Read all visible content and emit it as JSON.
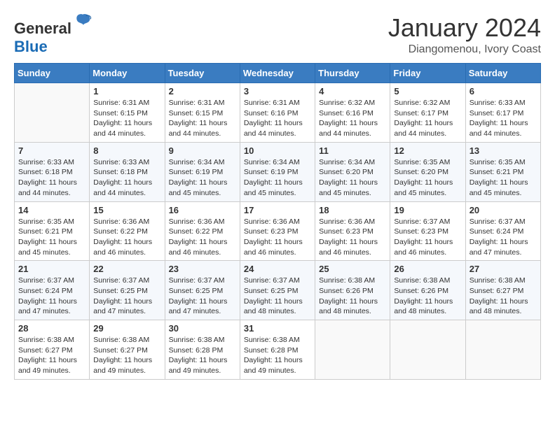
{
  "header": {
    "logo": {
      "general": "General",
      "blue": "Blue"
    },
    "title": "January 2024",
    "location": "Diangomenou, Ivory Coast"
  },
  "calendar": {
    "days_of_week": [
      "Sunday",
      "Monday",
      "Tuesday",
      "Wednesday",
      "Thursday",
      "Friday",
      "Saturday"
    ],
    "weeks": [
      [
        {
          "day": "",
          "info": ""
        },
        {
          "day": "1",
          "info": "Sunrise: 6:31 AM\nSunset: 6:15 PM\nDaylight: 11 hours\nand 44 minutes."
        },
        {
          "day": "2",
          "info": "Sunrise: 6:31 AM\nSunset: 6:15 PM\nDaylight: 11 hours\nand 44 minutes."
        },
        {
          "day": "3",
          "info": "Sunrise: 6:31 AM\nSunset: 6:16 PM\nDaylight: 11 hours\nand 44 minutes."
        },
        {
          "day": "4",
          "info": "Sunrise: 6:32 AM\nSunset: 6:16 PM\nDaylight: 11 hours\nand 44 minutes."
        },
        {
          "day": "5",
          "info": "Sunrise: 6:32 AM\nSunset: 6:17 PM\nDaylight: 11 hours\nand 44 minutes."
        },
        {
          "day": "6",
          "info": "Sunrise: 6:33 AM\nSunset: 6:17 PM\nDaylight: 11 hours\nand 44 minutes."
        }
      ],
      [
        {
          "day": "7",
          "info": "Sunrise: 6:33 AM\nSunset: 6:18 PM\nDaylight: 11 hours\nand 44 minutes."
        },
        {
          "day": "8",
          "info": "Sunrise: 6:33 AM\nSunset: 6:18 PM\nDaylight: 11 hours\nand 44 minutes."
        },
        {
          "day": "9",
          "info": "Sunrise: 6:34 AM\nSunset: 6:19 PM\nDaylight: 11 hours\nand 45 minutes."
        },
        {
          "day": "10",
          "info": "Sunrise: 6:34 AM\nSunset: 6:19 PM\nDaylight: 11 hours\nand 45 minutes."
        },
        {
          "day": "11",
          "info": "Sunrise: 6:34 AM\nSunset: 6:20 PM\nDaylight: 11 hours\nand 45 minutes."
        },
        {
          "day": "12",
          "info": "Sunrise: 6:35 AM\nSunset: 6:20 PM\nDaylight: 11 hours\nand 45 minutes."
        },
        {
          "day": "13",
          "info": "Sunrise: 6:35 AM\nSunset: 6:21 PM\nDaylight: 11 hours\nand 45 minutes."
        }
      ],
      [
        {
          "day": "14",
          "info": "Sunrise: 6:35 AM\nSunset: 6:21 PM\nDaylight: 11 hours\nand 45 minutes."
        },
        {
          "day": "15",
          "info": "Sunrise: 6:36 AM\nSunset: 6:22 PM\nDaylight: 11 hours\nand 46 minutes."
        },
        {
          "day": "16",
          "info": "Sunrise: 6:36 AM\nSunset: 6:22 PM\nDaylight: 11 hours\nand 46 minutes."
        },
        {
          "day": "17",
          "info": "Sunrise: 6:36 AM\nSunset: 6:23 PM\nDaylight: 11 hours\nand 46 minutes."
        },
        {
          "day": "18",
          "info": "Sunrise: 6:36 AM\nSunset: 6:23 PM\nDaylight: 11 hours\nand 46 minutes."
        },
        {
          "day": "19",
          "info": "Sunrise: 6:37 AM\nSunset: 6:23 PM\nDaylight: 11 hours\nand 46 minutes."
        },
        {
          "day": "20",
          "info": "Sunrise: 6:37 AM\nSunset: 6:24 PM\nDaylight: 11 hours\nand 47 minutes."
        }
      ],
      [
        {
          "day": "21",
          "info": "Sunrise: 6:37 AM\nSunset: 6:24 PM\nDaylight: 11 hours\nand 47 minutes."
        },
        {
          "day": "22",
          "info": "Sunrise: 6:37 AM\nSunset: 6:25 PM\nDaylight: 11 hours\nand 47 minutes."
        },
        {
          "day": "23",
          "info": "Sunrise: 6:37 AM\nSunset: 6:25 PM\nDaylight: 11 hours\nand 47 minutes."
        },
        {
          "day": "24",
          "info": "Sunrise: 6:37 AM\nSunset: 6:25 PM\nDaylight: 11 hours\nand 48 minutes."
        },
        {
          "day": "25",
          "info": "Sunrise: 6:38 AM\nSunset: 6:26 PM\nDaylight: 11 hours\nand 48 minutes."
        },
        {
          "day": "26",
          "info": "Sunrise: 6:38 AM\nSunset: 6:26 PM\nDaylight: 11 hours\nand 48 minutes."
        },
        {
          "day": "27",
          "info": "Sunrise: 6:38 AM\nSunset: 6:27 PM\nDaylight: 11 hours\nand 48 minutes."
        }
      ],
      [
        {
          "day": "28",
          "info": "Sunrise: 6:38 AM\nSunset: 6:27 PM\nDaylight: 11 hours\nand 49 minutes."
        },
        {
          "day": "29",
          "info": "Sunrise: 6:38 AM\nSunset: 6:27 PM\nDaylight: 11 hours\nand 49 minutes."
        },
        {
          "day": "30",
          "info": "Sunrise: 6:38 AM\nSunset: 6:28 PM\nDaylight: 11 hours\nand 49 minutes."
        },
        {
          "day": "31",
          "info": "Sunrise: 6:38 AM\nSunset: 6:28 PM\nDaylight: 11 hours\nand 49 minutes."
        },
        {
          "day": "",
          "info": ""
        },
        {
          "day": "",
          "info": ""
        },
        {
          "day": "",
          "info": ""
        }
      ]
    ]
  }
}
